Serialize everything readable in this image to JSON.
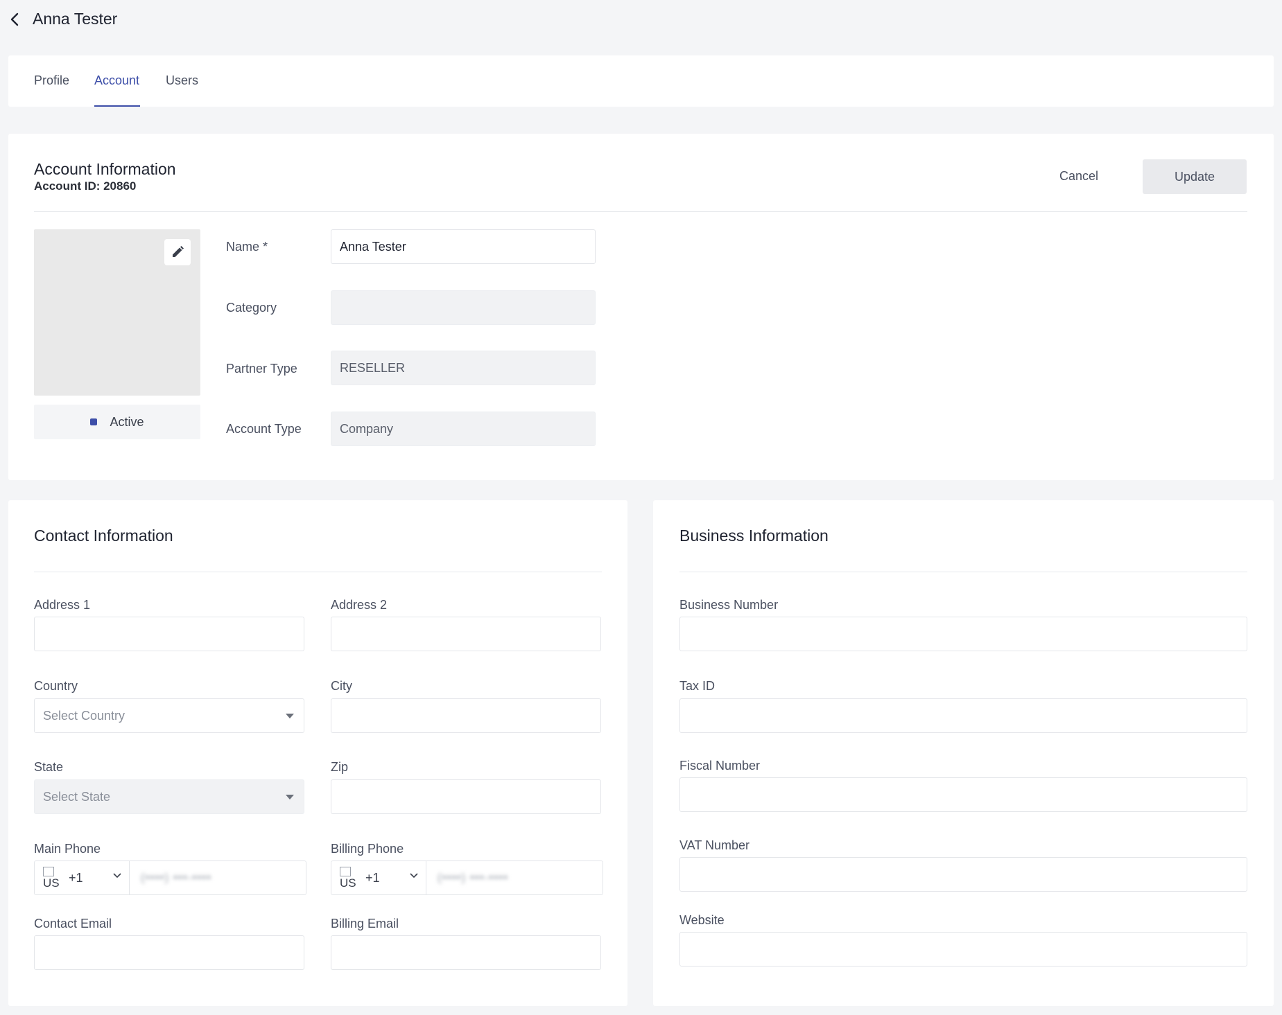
{
  "header": {
    "title": "Anna Tester"
  },
  "tabs": [
    {
      "label": "Profile",
      "active": false
    },
    {
      "label": "Account",
      "active": true
    },
    {
      "label": "Users",
      "active": false
    }
  ],
  "account": {
    "title": "Account Information",
    "account_id": "Account ID: 20860",
    "cancel_label": "Cancel",
    "update_label": "Update",
    "status": "Active",
    "fields": {
      "name_label": "Name *",
      "name_value": "Anna Tester",
      "category_label": "Category",
      "category_value": "",
      "partner_type_label": "Partner Type",
      "partner_type_value": "RESELLER",
      "account_type_label": "Account Type",
      "account_type_value": "Company"
    }
  },
  "contact": {
    "title": "Contact Information",
    "address1_label": "Address 1",
    "address2_label": "Address 2",
    "country_label": "Country",
    "country_placeholder": "Select Country",
    "city_label": "City",
    "state_label": "State",
    "state_placeholder": "Select State",
    "zip_label": "Zip",
    "main_phone_label": "Main Phone",
    "main_phone_flag_alt": "US",
    "main_phone_dial": "+1",
    "main_phone_number": "(••••) •••-••••",
    "billing_phone_label": "Billing Phone",
    "billing_phone_flag_alt": "US",
    "billing_phone_dial": "+1",
    "billing_phone_number": "(••••) •••-••••",
    "contact_email_label": "Contact Email",
    "billing_email_label": "Billing Email"
  },
  "business": {
    "title": "Business Information",
    "business_number_label": "Business Number",
    "tax_id_label": "Tax ID",
    "fiscal_number_label": "Fiscal Number",
    "vat_number_label": "VAT Number",
    "website_label": "Website"
  },
  "colors": {
    "accent": "#3d4ea8",
    "page_bg": "#f4f5f7"
  }
}
